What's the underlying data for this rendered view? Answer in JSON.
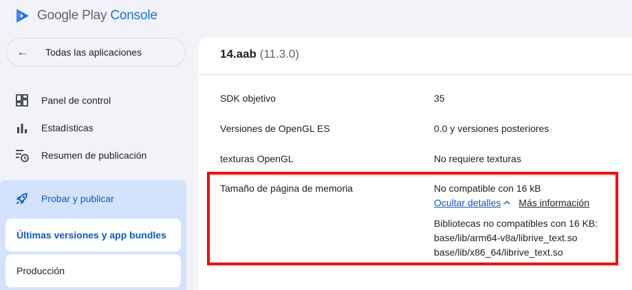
{
  "app": {
    "brand_primary": "Google Play",
    "brand_accent": "Console"
  },
  "sidebar": {
    "back_label": "Todas las aplicaciones",
    "items": [
      {
        "label": "Panel de control",
        "icon": "dashboard-icon"
      },
      {
        "label": "Estadísticas",
        "icon": "bar-chart-icon"
      },
      {
        "label": "Resumen de publicación",
        "icon": "publishing-overview-icon"
      }
    ],
    "section": {
      "label": "Probar y publicar",
      "icon": "rocket-icon",
      "sub_items": [
        {
          "label": "Últimas versiones y app bundles",
          "active": true
        },
        {
          "label": "Producción",
          "active": false
        }
      ]
    }
  },
  "main": {
    "title_name": "14.aab",
    "title_version": "(11.3.0)",
    "rows": [
      {
        "label": "SDK objetivo",
        "value": "35"
      },
      {
        "label": "Versiones de OpenGL ES",
        "value": "0.0 y versiones posteriores"
      },
      {
        "label": "texturas OpenGL",
        "value": "No requiere texturas"
      },
      {
        "label": "Tamaño de página de memoria",
        "value": "No compatible con 16 kB"
      }
    ],
    "hide_details_link": "Ocultar detalles",
    "more_info_link": "Más información",
    "libs_heading": "Bibliotecas no compatibles con 16 KB:",
    "libs": [
      "base/lib/arm64-v8a/librive_text.so",
      "base/lib/x86_64/librive_text.so"
    ]
  },
  "colors": {
    "accent": "#0b57d0",
    "section_bg": "#d3e3fd",
    "highlight": "#ff0000"
  }
}
